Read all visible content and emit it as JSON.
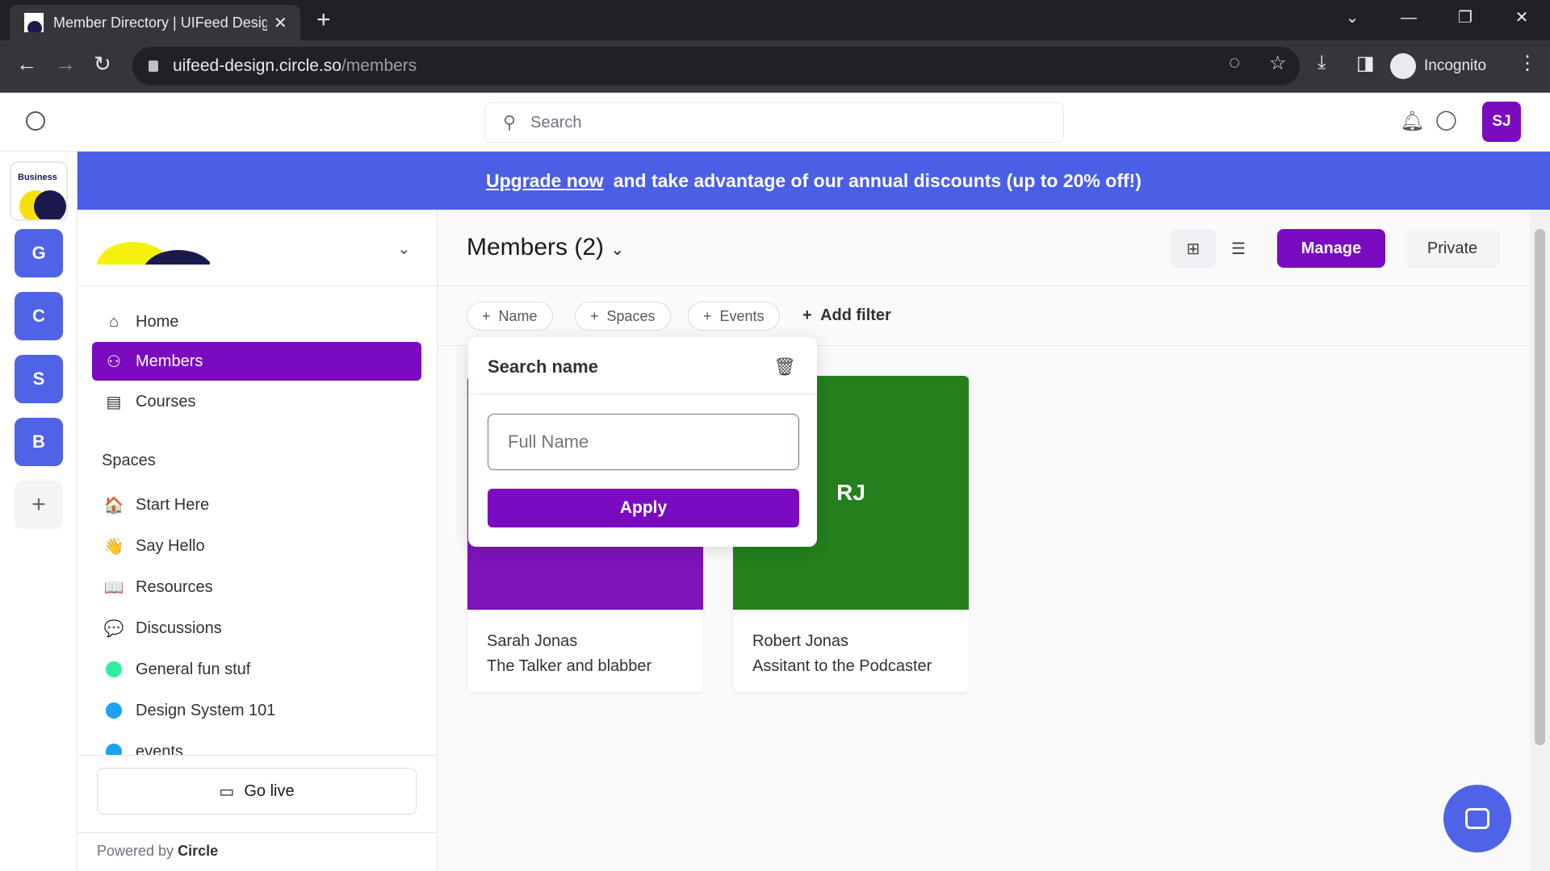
{
  "browser": {
    "tab_title": "Member Directory | UIFeed Design",
    "url_host": "uifeed-design.circle.so",
    "url_path": "/members",
    "profile": "Incognito"
  },
  "header": {
    "search_placeholder": "Search",
    "avatar": "SJ"
  },
  "rail": {
    "brand": "Business",
    "communities": [
      "G",
      "C",
      "S",
      "B"
    ],
    "add": "+"
  },
  "banner": {
    "link": "Upgrade now",
    "text": "and take advantage of our annual discounts (up to 20% off!)"
  },
  "sidebar": {
    "nav": [
      {
        "label": "Home",
        "icon": "home-icon"
      },
      {
        "label": "Members",
        "icon": "members-icon",
        "active": true
      },
      {
        "label": "Courses",
        "icon": "courses-icon"
      }
    ],
    "spaces_heading": "Spaces",
    "spaces": [
      {
        "label": "Start Here",
        "emoji": "🏠"
      },
      {
        "label": "Say Hello",
        "emoji": "👋"
      },
      {
        "label": "Resources",
        "emoji": "📖"
      },
      {
        "label": "Discussions",
        "emoji": "💬"
      },
      {
        "label": "General fun stuf",
        "color": "#2ef0a0"
      },
      {
        "label": "Design System 101",
        "color": "#1da1f2"
      },
      {
        "label": "events",
        "color": "#1da1f2"
      }
    ],
    "go_live": "Go live",
    "powered_by": "Powered by",
    "powered_brand": "Circle"
  },
  "main": {
    "title": "Members (2)",
    "manage": "Manage",
    "private": "Private",
    "filters": [
      "Name",
      "Spaces",
      "Events"
    ],
    "add_filter": "Add filter",
    "popup": {
      "title": "Search name",
      "placeholder": "Full Name",
      "apply": "Apply"
    },
    "members": [
      {
        "initials": "",
        "name": "Sarah Jonas",
        "headline": "The Talker and blabber",
        "color": "#7e12bb"
      },
      {
        "initials": "RJ",
        "name": "Robert Jonas",
        "headline": "Assitant to the Podcaster",
        "color": "#23801d"
      }
    ]
  },
  "colors": {
    "accent": "#7a0bc0",
    "banner": "#4a5fe6"
  }
}
